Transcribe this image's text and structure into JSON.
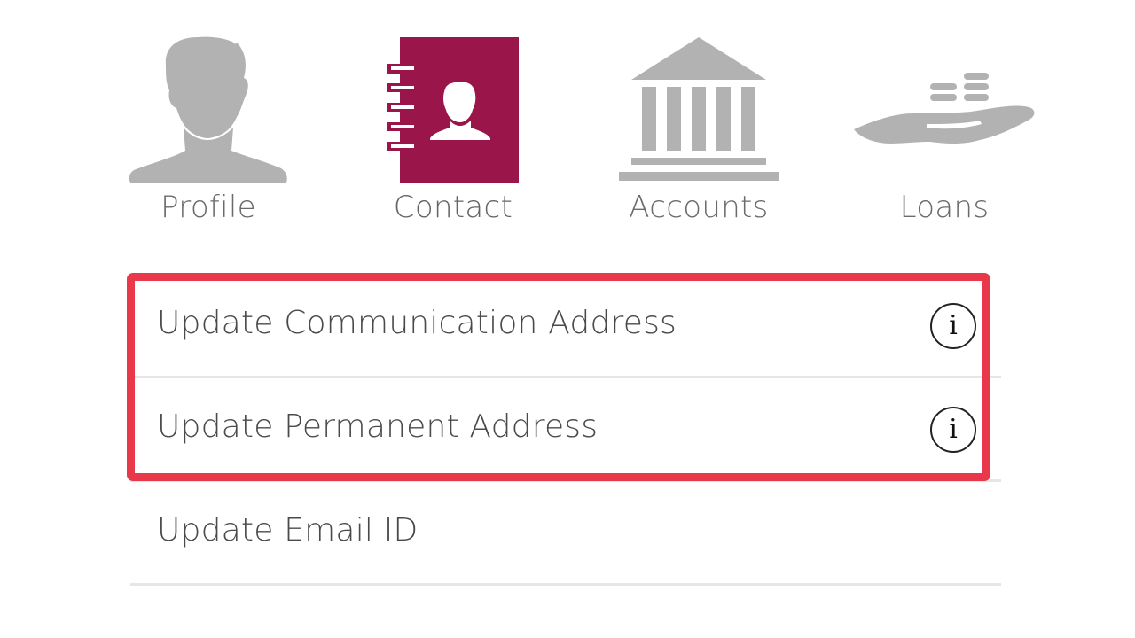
{
  "tabs": [
    {
      "id": "profile",
      "label": "Profile",
      "icon": "person-silhouette-icon",
      "active": false
    },
    {
      "id": "contact",
      "label": "Contact",
      "icon": "contact-book-icon",
      "active": true
    },
    {
      "id": "accounts",
      "label": "Accounts",
      "icon": "bank-building-icon",
      "active": false
    },
    {
      "id": "loans",
      "label": "Loans",
      "icon": "hand-coins-icon",
      "active": false
    }
  ],
  "options": [
    {
      "label": "Update Communication Address",
      "info_glyph": "i",
      "has_info": true
    },
    {
      "label": "Update Permanent Address",
      "info_glyph": "i",
      "has_info": true
    },
    {
      "label": "Update Email ID",
      "has_info": false
    }
  ],
  "colors": {
    "active_tab": "#99154a",
    "inactive_icon": "#b2b2b2",
    "highlight": "#e8384a",
    "divider": "#e6e6e6"
  }
}
